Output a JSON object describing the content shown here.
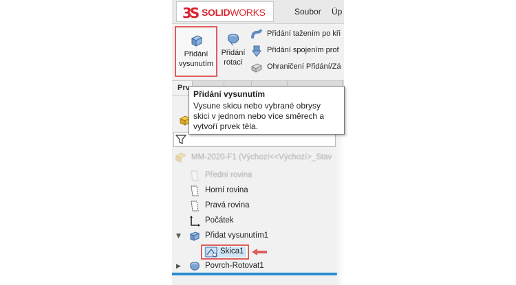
{
  "app": {
    "logo_mark": "3S",
    "logo_bold": "SOLID",
    "logo_thin": "WORKS",
    "menu": [
      "Soubor",
      "Úp"
    ]
  },
  "ribbon": {
    "extrude_line1": "Přidání",
    "extrude_line2": "vysunutím",
    "revolve_line1": "Přidání",
    "revolve_line2": "rotací",
    "sweep": "Přidání tažením po kři",
    "loft": "Přidání spojením prof",
    "boundary": "Ohraničení Přidání/Zá"
  },
  "tabs": [
    "Prv"
  ],
  "tooltip": {
    "title": "Přidání vysunutím",
    "body": "Vysune skicu nebo vybrané obrysy skici v jednom nebo více směrech a vytvoří prvek těla."
  },
  "tree": {
    "root": "MM-2020-F1 (Výchozí<<Výchozí>_Stav",
    "front_plane": "Přední rovina",
    "top_plane": "Horní rovina",
    "right_plane": "Pravá rovina",
    "origin": "Počátek",
    "extrude_feature": "Přidat vysunutím1",
    "sketch": "Skica1",
    "surface_revolve": "Povrch-Rotovat1"
  },
  "colors": {
    "brand_red": "#d9232e",
    "highlight_border": "#e05c5c",
    "selection_blue": "#cfe6f7",
    "accent_blue": "#2b8ad1"
  }
}
